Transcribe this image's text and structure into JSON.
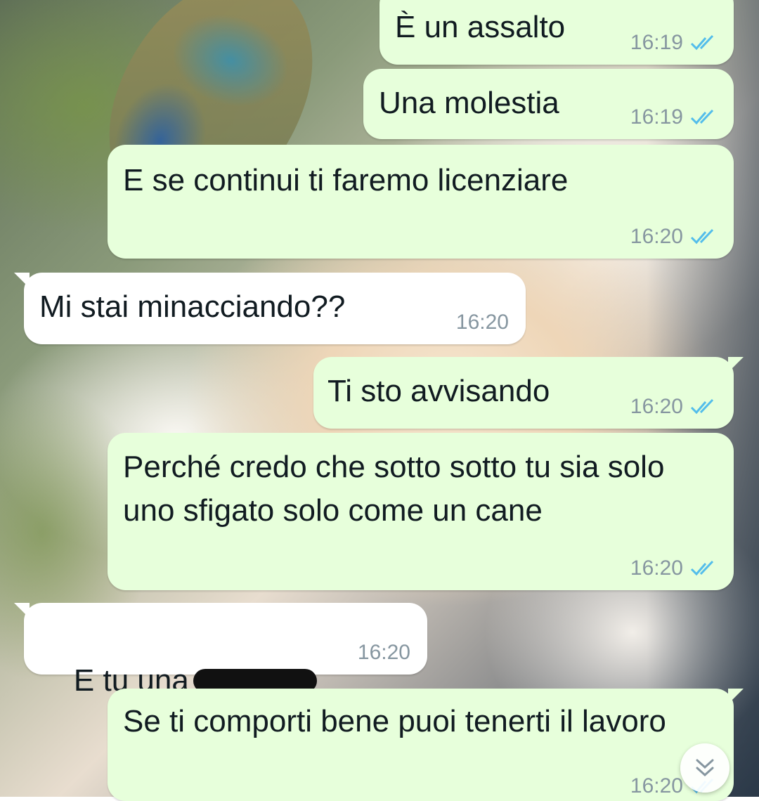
{
  "chat": {
    "messages": [
      {
        "direction": "outgoing",
        "text": "È un assalto",
        "time": "16:19",
        "status_icon": "double-check-read-icon"
      },
      {
        "direction": "outgoing",
        "text": "Una molestia",
        "time": "16:19",
        "status_icon": "double-check-read-icon"
      },
      {
        "direction": "outgoing",
        "text": "E se continui ti faremo licenziare",
        "time": "16:20",
        "status_icon": "double-check-read-icon"
      },
      {
        "direction": "incoming",
        "text": "Mi stai minacciando??",
        "time": "16:20"
      },
      {
        "direction": "outgoing",
        "text": "Ti sto avvisando",
        "time": "16:20",
        "status_icon": "double-check-read-icon"
      },
      {
        "direction": "outgoing",
        "text": "Perché credo che sotto sotto tu sia solo uno sfigato solo come un cane",
        "time": "16:20",
        "status_icon": "double-check-read-icon"
      },
      {
        "direction": "incoming",
        "text": "E tu una",
        "time": "16:20",
        "redacted": true
      },
      {
        "direction": "outgoing",
        "text": "Se ti comporti bene puoi tenerti il lavoro",
        "time": "16:20",
        "status_icon": "double-check-read-icon"
      }
    ]
  },
  "colors": {
    "outgoing_bubble": "#e7ffdb",
    "incoming_bubble": "#ffffff",
    "read_tick": "#53bdeb",
    "time_text": "#8696a0"
  },
  "scroll_button": {
    "icon": "chevron-double-down-icon"
  }
}
